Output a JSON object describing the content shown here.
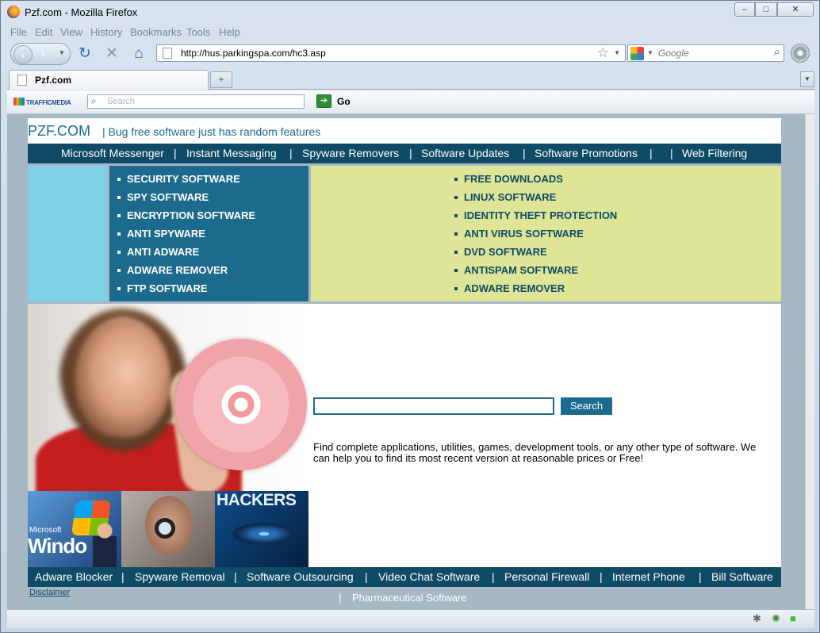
{
  "window": {
    "title": "Pzf.com - Mozilla Firefox",
    "min": "‒",
    "max": "□",
    "close": "✕"
  },
  "menu": [
    "File",
    "Edit",
    "View",
    "History",
    "Bookmarks",
    "Tools",
    "Help"
  ],
  "nav": {
    "url": "http://hus.parkingspa.com/hc3.asp",
    "search_placeholder": "Google"
  },
  "tabs": {
    "active": "Pzf.com",
    "new_tab": "+"
  },
  "toolbar": {
    "brand": "TRAFFICMEDIA",
    "search_placeholder": "Search",
    "go": "Go"
  },
  "site": {
    "logo": "PZF.COM",
    "tagline": "| Bug free software just has random features",
    "top_nav": [
      "Microsoft Messenger",
      "Instant Messaging",
      "Spyware Removers",
      "Software Updates",
      "Software Promotions",
      "",
      "Web Filtering"
    ],
    "left_links": [
      "SECURITY SOFTWARE",
      "SPY SOFTWARE",
      "ENCRYPTION SOFTWARE",
      "ANTI SPYWARE",
      "ANTI ADWARE",
      "ADWARE REMOVER",
      "FTP SOFTWARE"
    ],
    "right_links": [
      "FREE DOWNLOADS",
      "LINUX SOFTWARE",
      "IDENTITY THEFT PROTECTION",
      "ANTI VIRUS SOFTWARE",
      "DVD SOFTWARE",
      "ANTISPAM SOFTWARE",
      "ADWARE REMOVER"
    ],
    "thumb_texts": {
      "ms": "Microsoft",
      "windows": "Windo",
      "hackers": "HACKERS"
    },
    "search_button": "Search",
    "description": "Find complete applications, utilities, games, development tools, or any other type of software. We can help you to find its most recent version at reasonable prices or Free!",
    "bottom_nav": [
      "Adware Blocker",
      "Spyware Removal",
      "Software Outsourcing",
      "Video Chat Software",
      "Personal Firewall",
      "Internet Phone",
      "Bill Software"
    ],
    "disclaimer": "Disclaimer",
    "pharma_sep": "|",
    "pharma": "Pharmaceutical Software"
  },
  "colors": {
    "nav_bg": "#0f4a66",
    "blue_col": "#1c6b8f",
    "yellow_col": "#dfe596",
    "light_col": "#7fd1e6"
  }
}
